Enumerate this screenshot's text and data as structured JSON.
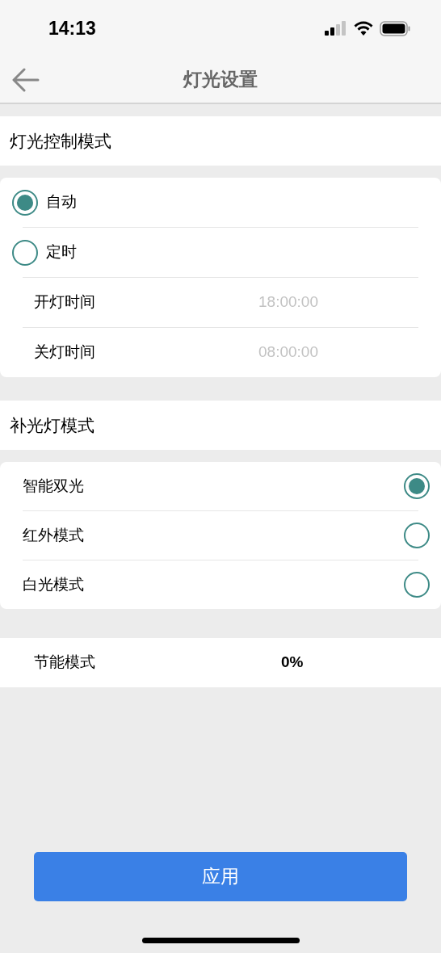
{
  "status_bar": {
    "time": "14:13"
  },
  "nav": {
    "title": "灯光设置"
  },
  "light_control": {
    "title": "灯光控制模式",
    "options": [
      {
        "label": "自动",
        "selected": true
      },
      {
        "label": "定时",
        "selected": false
      }
    ],
    "schedule": [
      {
        "label": "开灯时间",
        "value": "18:00:00"
      },
      {
        "label": "关灯时间",
        "value": "08:00:00"
      }
    ]
  },
  "fill_light": {
    "title": "补光灯模式",
    "options": [
      {
        "label": "智能双光",
        "selected": true
      },
      {
        "label": "红外模式",
        "selected": false
      },
      {
        "label": "白光模式",
        "selected": false
      }
    ]
  },
  "energy_saving": {
    "label": "节能模式",
    "value": "0%"
  },
  "apply_button": "应用"
}
